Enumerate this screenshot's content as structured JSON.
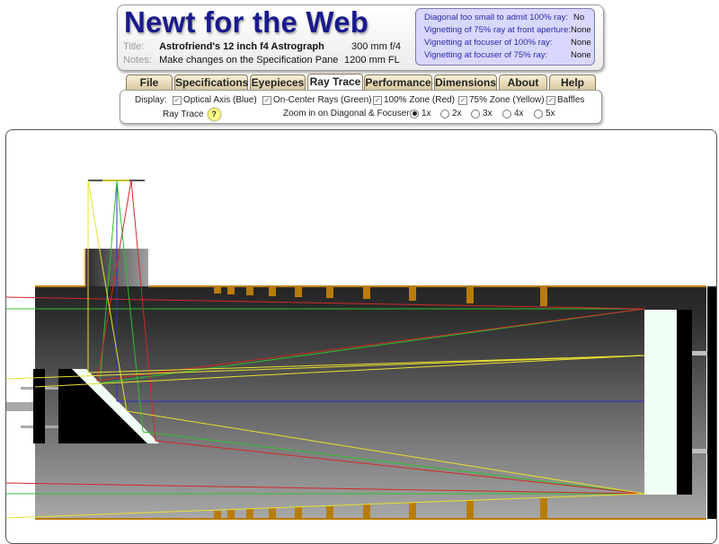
{
  "app": {
    "title": "Newt for the Web",
    "title_label": "Title:",
    "title_value": "Astrofriend's 12 inch f4 Astrograph",
    "notes_label": "Notes:",
    "notes_value": "Make changes on the Specification Pane",
    "aperture_focal_ratio": "300 mm f/4",
    "focal_length": "1200 mm FL"
  },
  "status": {
    "rows": [
      {
        "label": "Diagonal too small to admit 100% ray:",
        "value": "No"
      },
      {
        "label": "Vignetting of 75% ray at front aperture:",
        "value": "None"
      },
      {
        "label": "Vignetting at focuser of 100% ray:",
        "value": "None"
      },
      {
        "label": "Vignetting at focuser of   75% ray:",
        "value": "None"
      }
    ]
  },
  "tabs": [
    {
      "label": "File",
      "active": false
    },
    {
      "label": "Specifications",
      "active": false
    },
    {
      "label": "Eyepieces",
      "active": false
    },
    {
      "label": "Ray Trace",
      "active": true
    },
    {
      "label": "Performance",
      "active": false
    },
    {
      "label": "Dimensions",
      "active": false
    },
    {
      "label": "About",
      "active": false
    },
    {
      "label": "Help",
      "active": false
    }
  ],
  "display": {
    "label": "Display:",
    "options": [
      {
        "label": "Optical Axis (Blue)",
        "checked": true
      },
      {
        "label": "On-Center Rays (Green)",
        "checked": true
      },
      {
        "label": "100% Zone (Red)",
        "checked": true
      },
      {
        "label": "75% Zone (Yellow)",
        "checked": true
      },
      {
        "label": "Baffles",
        "checked": true
      }
    ],
    "ray_trace_label": "Ray Trace",
    "help_glyph": "?",
    "zoom_label": "Zoom in on Diagonal & Focuser:",
    "zoom_options": [
      "1x",
      "2x",
      "3x",
      "4x",
      "5x"
    ],
    "zoom_selected": "1x",
    "check_glyph": "✓"
  },
  "colors": {
    "optical_axis": "#3030c8",
    "on_center": "#30c030",
    "zone_100": "#d02828",
    "zone_75": "#e8e030",
    "baffle": "#b87c08",
    "tube_top": "#262626",
    "tube_bottom": "#a8a8a8",
    "mirror": "#f0fff4"
  }
}
